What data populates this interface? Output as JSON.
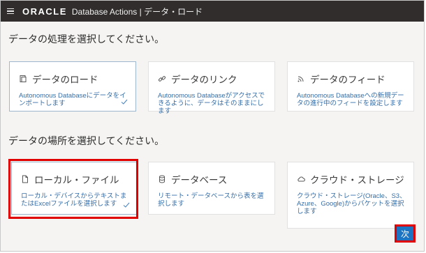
{
  "topbar": {
    "brand": "ORACLE",
    "title": "Database Actions | データ・ロード"
  },
  "sections": [
    {
      "heading": "データの処理を選択してください。",
      "cards": [
        {
          "icon": "load-icon",
          "title": "データのロード",
          "desc": "Autonomous Databaseにデータをインポートします",
          "selected": true
        },
        {
          "icon": "link-icon",
          "title": "データのリンク",
          "desc": "Autonomous Databaseがアクセスできるように、データはそのままにします",
          "selected": false
        },
        {
          "icon": "feed-icon",
          "title": "データのフィード",
          "desc": "Autonomous Databaseへの新規データの進行中のフィードを設定します",
          "selected": false
        }
      ]
    },
    {
      "heading": "データの場所を選択してください。",
      "cards": [
        {
          "icon": "file-icon",
          "title": "ローカル・ファイル",
          "desc": "ローカル・デバイスからテキストまたはExcelファイルを選択します",
          "selected": true
        },
        {
          "icon": "database-icon",
          "title": "データベース",
          "desc": "リモート・データベースから表を選択します",
          "selected": false
        },
        {
          "icon": "cloud-icon",
          "title": "クラウド・ストレージ",
          "desc": "クラウド・ストレージ(Oracle、S3、Azure、Google)からバケットを選択します",
          "selected": false
        }
      ]
    }
  ],
  "footer": {
    "next_label": "次"
  },
  "colors": {
    "topbar": "#302d2c",
    "accent": "#1d74c2",
    "highlight": "#e00000",
    "link_text": "#356ea8"
  }
}
